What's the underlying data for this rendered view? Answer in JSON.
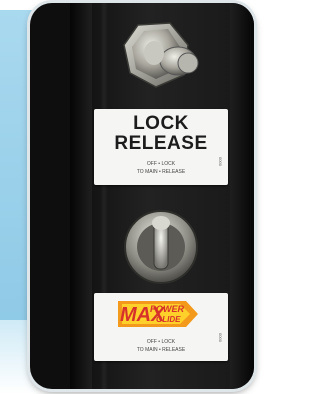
{
  "lock_label": {
    "line1": "LOCK",
    "line2": "RELEASE",
    "small1": "OFF • LOCK",
    "small2": "TO MAIN • RELEASE",
    "side": "0000"
  },
  "power_label": {
    "brand_big": "MAX",
    "word1": "POWER",
    "word2": "GLIDE",
    "small1": "OFF • LOCK",
    "small2": "TO MAIN • RELEASE",
    "side": "0000"
  },
  "colors": {
    "backdrop_blue": "#a9d9ef",
    "panel_black": "#141414",
    "logo_orange": "#f39a1c",
    "logo_red": "#d6322b",
    "logo_yellow": "#ffd02a"
  },
  "icons": [
    "hex-nut-switch-icon",
    "round-knob-switch-icon"
  ]
}
